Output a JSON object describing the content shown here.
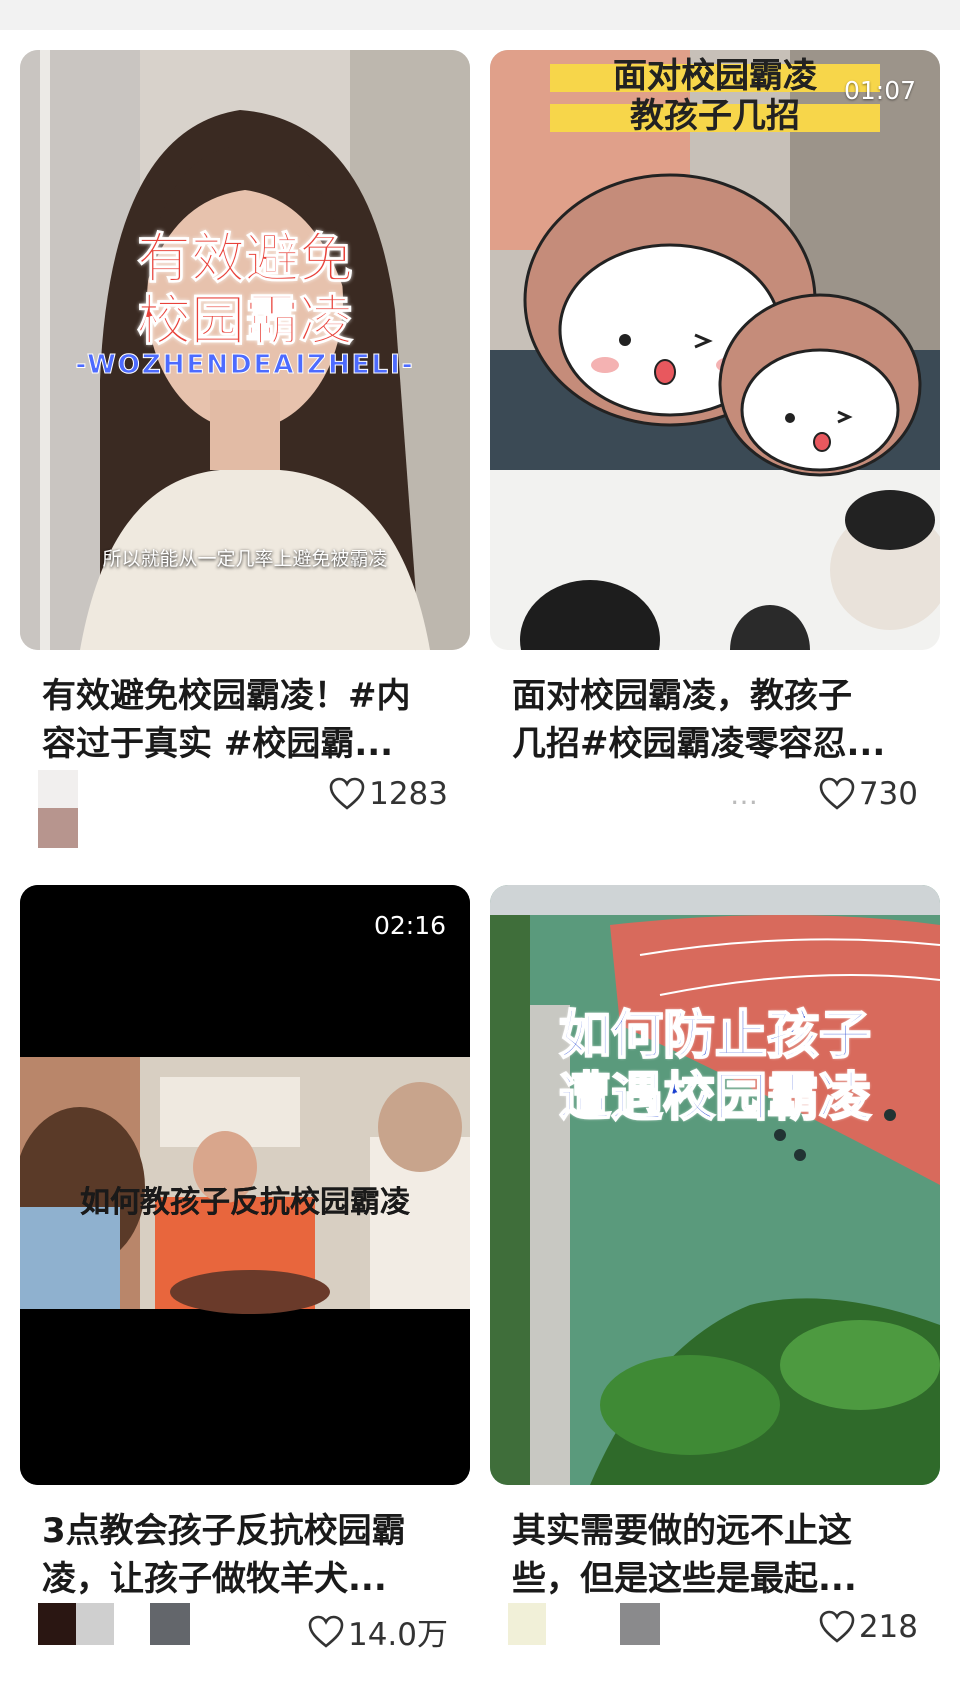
{
  "cards": [
    {
      "overlay_title_l1": "有效避免",
      "overlay_title_l2": "校园霸凌",
      "overlay_sub": "-WOZHENDEAIZHELI-",
      "subtitle": "所以就能从一定几率上避免被霸凌",
      "title": "有效避免校园霸凌！#内\n容过于真实 #校园霸...",
      "likes": "1283",
      "author": ""
    },
    {
      "duration": "01:07",
      "overlay_title_l1": "面对校园霸凌",
      "overlay_title_l2": "教孩子几招",
      "title": "面对校园霸凌，教孩子\n几招#校园霸凌零容忍...",
      "likes": "730",
      "author": "…"
    },
    {
      "duration": "02:16",
      "overlay_caption": "如何教孩子反抗校园霸凌",
      "title": "3点教会孩子反抗校园霸\n凌，让孩子做牧羊犬...",
      "likes": "14.0万",
      "author": ""
    },
    {
      "overlay_title_l1": "如何防止孩子",
      "overlay_title_l2": "遭遇校园霸凌",
      "title": "其实需要做的远不止这\n些，但是这些是最起...",
      "likes": "218",
      "author": ""
    }
  ],
  "icons": {
    "like": "heart-outline-icon"
  },
  "colors": {
    "overlay_red": "#e8423a",
    "overlay_yellow": "#f7d64a",
    "overlay_blue": "#1a3fd0",
    "track_red": "#d86a5c",
    "field_green": "#5a9a7c"
  }
}
